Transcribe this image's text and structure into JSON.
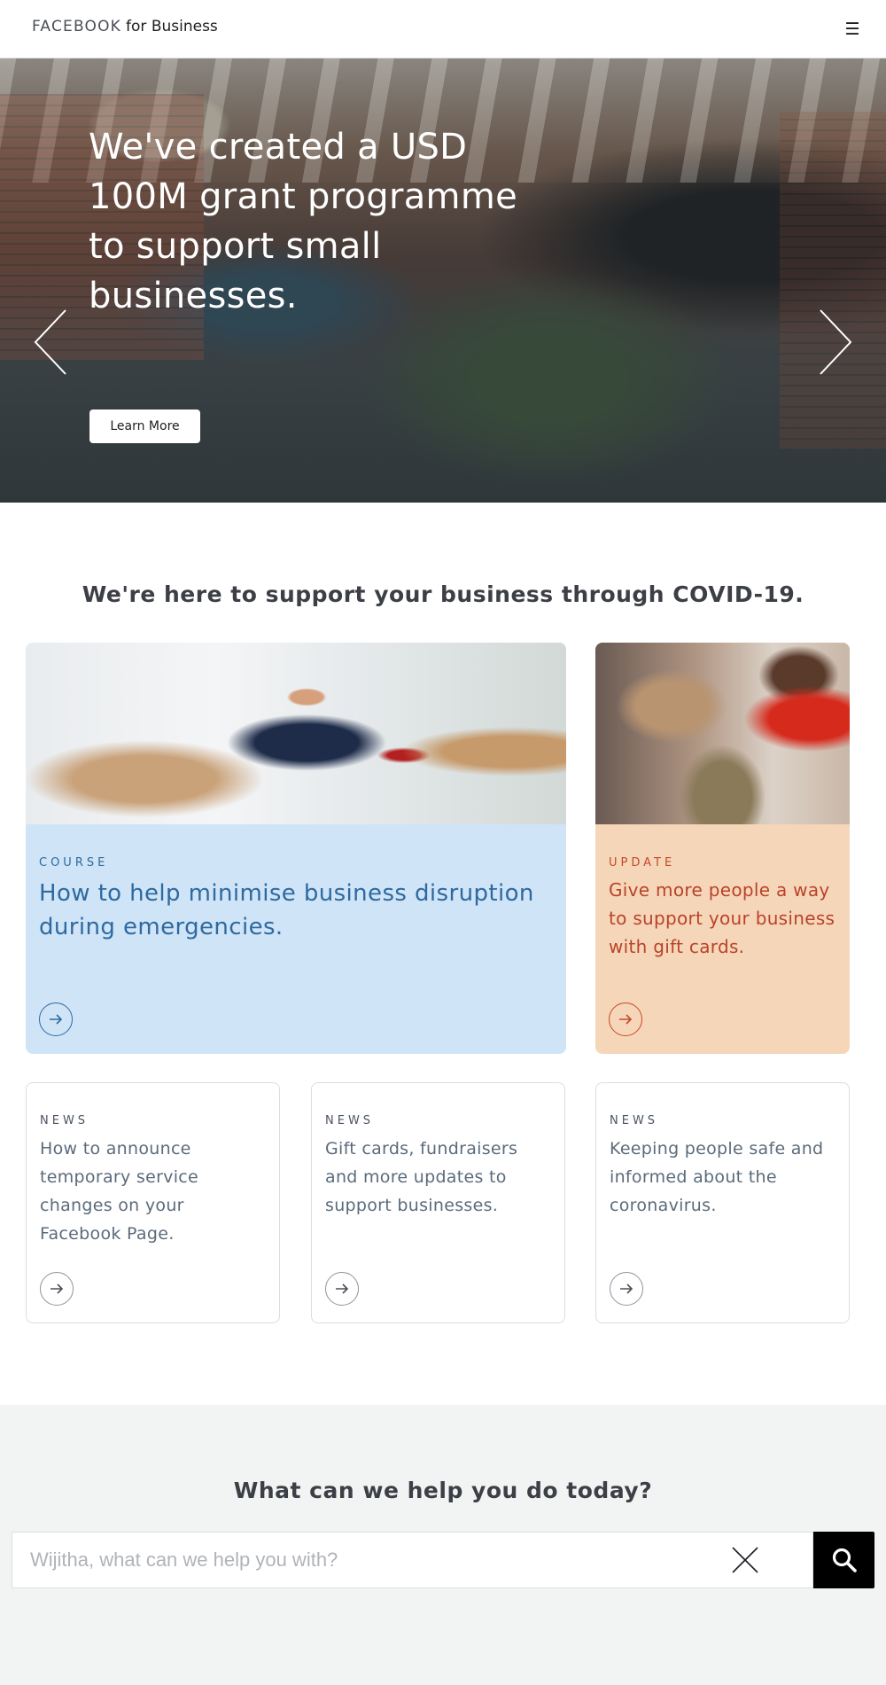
{
  "header": {
    "brand": "FACEBOOK",
    "brand_suffix": "for Business",
    "menu_icon": "hamburger-menu-icon",
    "menu_glyph": "☰"
  },
  "hero": {
    "title": "We've created a USD 100M grant programme to support small businesses.",
    "button_label": "Learn More",
    "prev_icon": "chevron-left-icon",
    "next_icon": "chevron-right-icon",
    "slides": 2,
    "active_slide": 1
  },
  "covid": {
    "title": "We're here to support your business through COVID-19.",
    "featured": [
      {
        "tag": "COURSE",
        "heading": "How to help minimise business disruption during emergencies.",
        "color": "#2e6aa0",
        "background": "#cfe4f7"
      },
      {
        "tag": "UPDATE",
        "heading": "Give more people a way to support your business with gift cards.",
        "color": "#b8432a",
        "background": "#f6d6b9"
      }
    ],
    "news": [
      {
        "tag": "NEWS",
        "heading": "How to announce temporary service changes on your Facebook Page."
      },
      {
        "tag": "NEWS",
        "heading": "Gift cards, fundraisers and more updates to support businesses."
      },
      {
        "tag": "NEWS",
        "heading": "Keeping people safe and informed about the coronavirus."
      }
    ],
    "arrow_glyph": "→"
  },
  "help": {
    "title": "What can we help you do today?",
    "search_placeholder": "Wijitha, what can we help you with?",
    "search_value": "",
    "clear_icon": "close-icon",
    "search_icon": "search-icon"
  },
  "colors": {
    "accent": "#1877f2",
    "dark": "#1c1e21",
    "help_bg": "#f2f3f3"
  }
}
